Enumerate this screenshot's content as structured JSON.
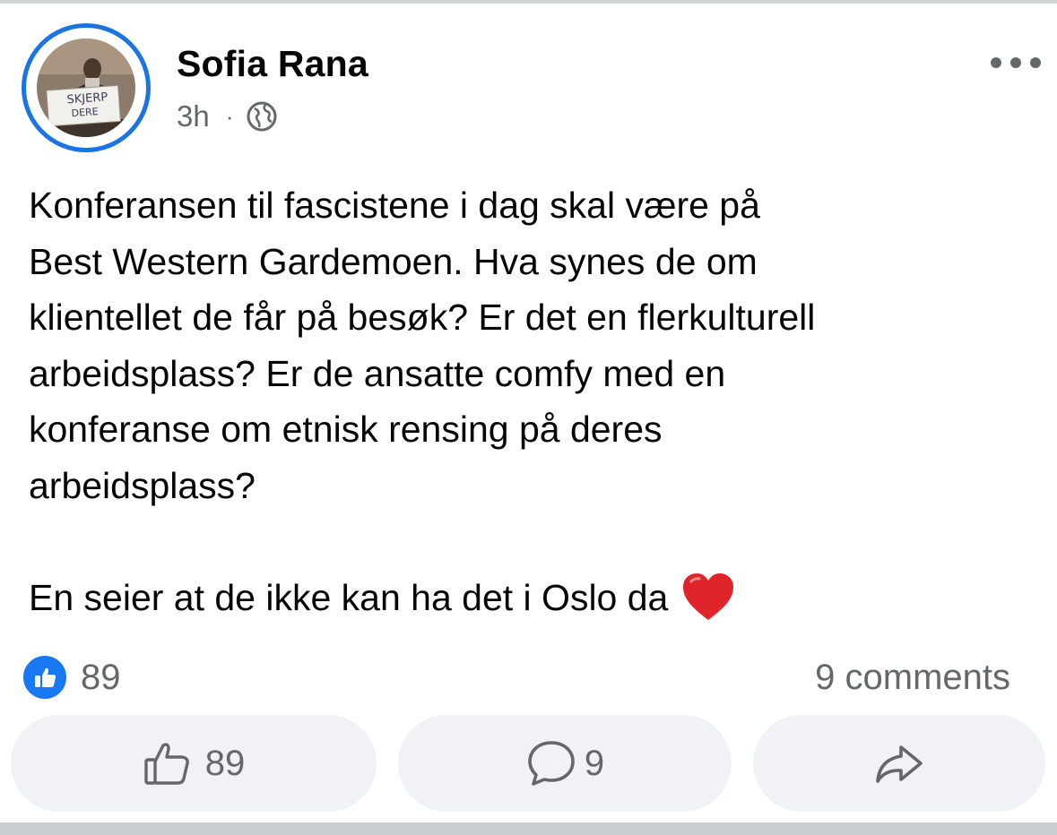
{
  "post": {
    "author": "Sofia Rana",
    "time": "3h",
    "separator": "·",
    "audience_icon": "globe-icon",
    "avatar_sign_line1": "SKJERP",
    "avatar_sign_line2": "DERE",
    "body_lines": [
      "Konferansen til fascistene i dag skal være på",
      "Best Western Gardemoen. Hva synes de om",
      "klientellet de får på besøk? Er det en flerkulturell",
      "arbeidsplass? Er de ansatte comfy med en",
      "konferanse om etnisk rensing på deres",
      "arbeidsplass?"
    ],
    "closing_line": "En seier at de ikke kan ha det i Oslo da",
    "closing_emoji": "red-heart-icon"
  },
  "stats": {
    "reaction_icon": "like-icon",
    "reaction_count": "89",
    "comments_text": "9 comments"
  },
  "actions": {
    "like_count": "89",
    "comment_count": "9",
    "share_icon": "share-icon"
  },
  "colors": {
    "accent": "#1877f2",
    "avatar_ring": "#1b74e4",
    "heart": "#e0242b",
    "secondary_text": "#65676b",
    "button_bg": "#f0f2f5"
  }
}
